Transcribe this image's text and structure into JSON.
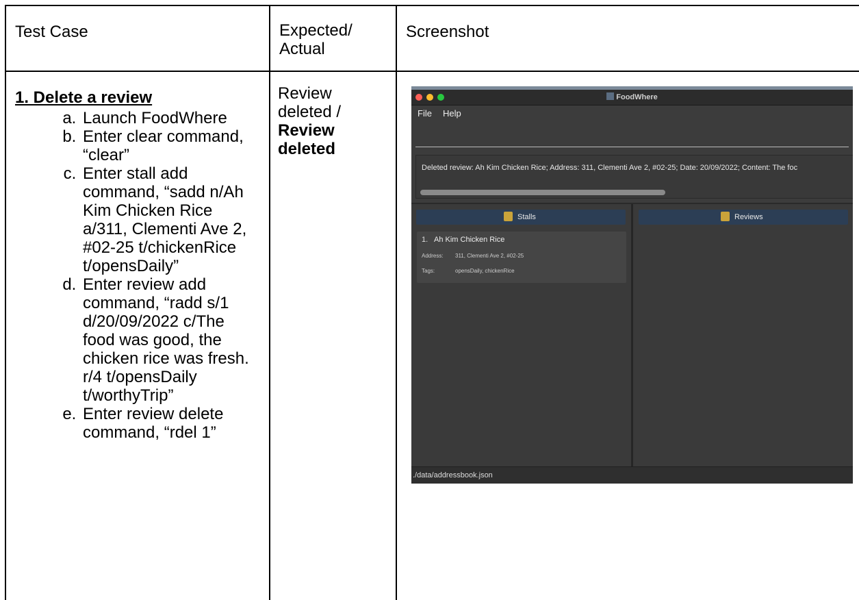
{
  "table": {
    "headers": [
      "Test Case",
      "Expected/ Actual",
      "Screenshot"
    ],
    "test_case": {
      "title": "1. Delete a review",
      "steps": [
        "Launch FoodWhere",
        "Enter clear command, “clear”",
        "Enter stall add command, “sadd n/Ah Kim Chicken Rice a/311, Clementi Ave 2, #02-25 t/chickenRice t/opensDaily”",
        "Enter review add command, “radd s/1 d/20/09/2022 c/The food was good, the chicken rice was fresh. r/4 t/opensDaily t/worthyTrip”",
        "Enter review delete command, “rdel 1”"
      ]
    },
    "expected": "Review deleted /",
    "actual": "Review deleted"
  },
  "app": {
    "window_title": "FoodWhere",
    "traffic_lights": [
      "#fe5f57",
      "#febc2e",
      "#28c840"
    ],
    "menu": [
      "File",
      "Help"
    ],
    "command_input": "",
    "result_text": "Deleted review: Ah Kim Chicken Rice; Address: 311, Clementi Ave 2, #02-25; Date: 20/09/2022; Content: The foc",
    "stalls_header": "Stalls",
    "reviews_header": "Reviews",
    "stall_card": {
      "index": "1.",
      "name": "Ah Kim Chicken Rice",
      "address_label": "Address:",
      "address": "311, Clementi Ave 2, #02-25",
      "tags_label": "Tags:",
      "tags": "opensDaily, chickenRice"
    },
    "status_path": "./data/addressbook.json",
    "colors": {
      "background": "#3c3c3c",
      "panel_header": "#2c3e55",
      "card": "#454545"
    }
  }
}
